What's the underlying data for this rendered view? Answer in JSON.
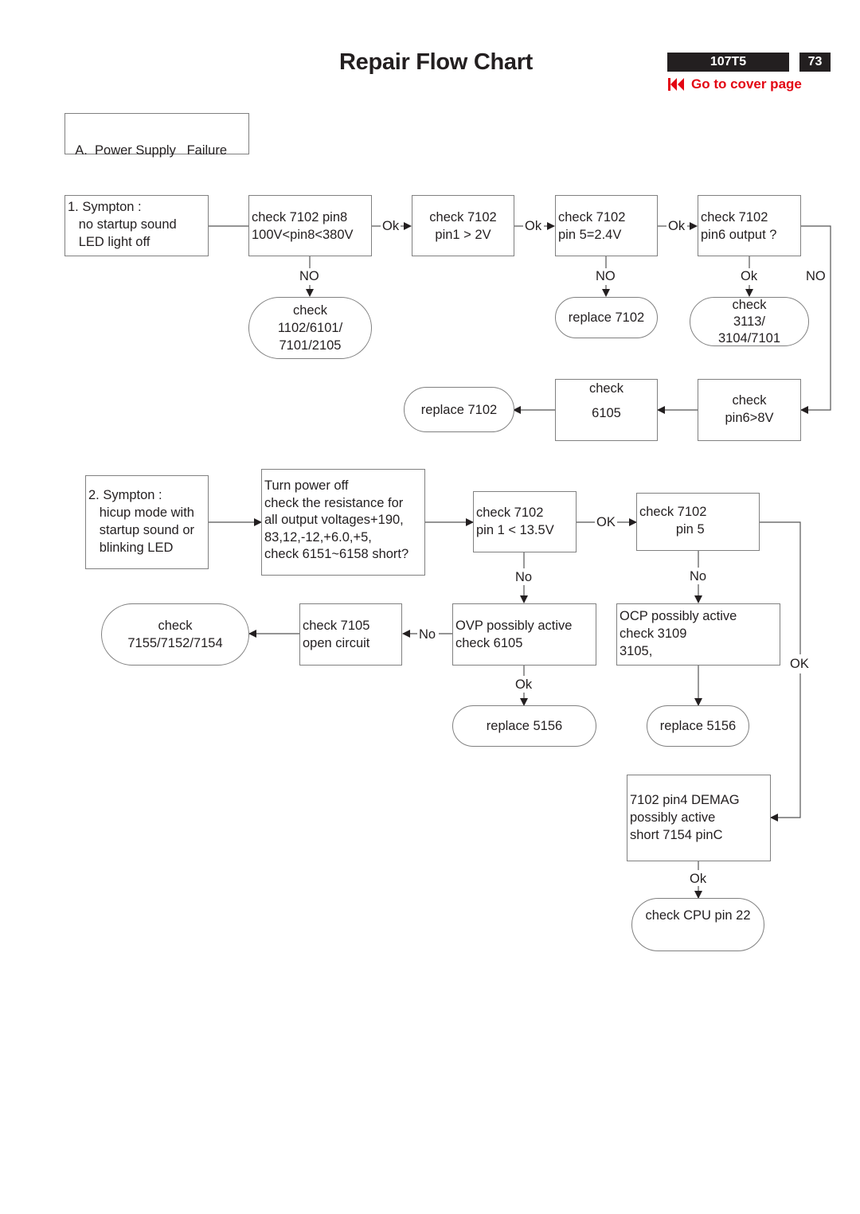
{
  "header": {
    "title": "Repair Flow Chart",
    "model": "107T5",
    "page_number": "73",
    "cover_link": "Go to cover page",
    "cover_icon": "skip-to-start-icon",
    "accent_color": "#e30613"
  },
  "section": {
    "title": "A.  Power Supply   Failure"
  },
  "flow1": {
    "symptom": "1. Sympton :\n   no startup sound\n   LED light off",
    "check_pin8": "check 7102 pin8\n100V<pin8<380V",
    "check_pin1": "check 7102\npin1 > 2V",
    "check_pin5": "check 7102\npin 5=2.4V",
    "check_pin6": "check 7102\npin6 output ?",
    "no_pin8_result": "check\n1102/6101/\n7101/2105",
    "no_pin5_result": "replace 7102",
    "ok_pin6_result": "check\n3113/\n3104/7101",
    "check_pin6_8v": "check\npin6>8V",
    "check_6105": "check\n\n6105",
    "replace_7102": "replace 7102",
    "labels": {
      "ok1": "Ok",
      "ok2": "Ok",
      "ok3": "Ok",
      "no_pin8": "NO",
      "no_pin5": "NO",
      "ok_pin6": "Ok",
      "no_pin6": "NO"
    }
  },
  "flow2": {
    "symptom": "2. Sympton :\n   hicup mode with\n   startup sound or\n   blinking LED",
    "resistance_check": "Turn power off\ncheck the resistance for\nall output voltages+190,\n83,12,-12,+6.0,+5,\ncheck 6151~6158 short?",
    "check_pin1": "check 7102\npin 1 < 13.5V",
    "check_pin5": "check 7102\n          pin 5",
    "ovp": "OVP possibly active\ncheck 6105",
    "ocp": "OCP possibly active\ncheck 3109\n3105,",
    "check_7105": "check 7105\nopen circuit",
    "check_715x": "check\n7155/7152/7154",
    "replace_5156_a": "replace 5156",
    "replace_5156_b": "replace 5156",
    "demag": "7102 pin4 DEMAG\npossibly active\nshort 7154 pinC",
    "check_cpu": "check CPU pin 22",
    "labels": {
      "ok_pin1": "OK",
      "no_pin1": "No",
      "no_pin5": "No",
      "no_ovp": "No",
      "ok_ovp": "Ok",
      "ok_pin5": "OK",
      "ok_demag": "Ok"
    }
  }
}
